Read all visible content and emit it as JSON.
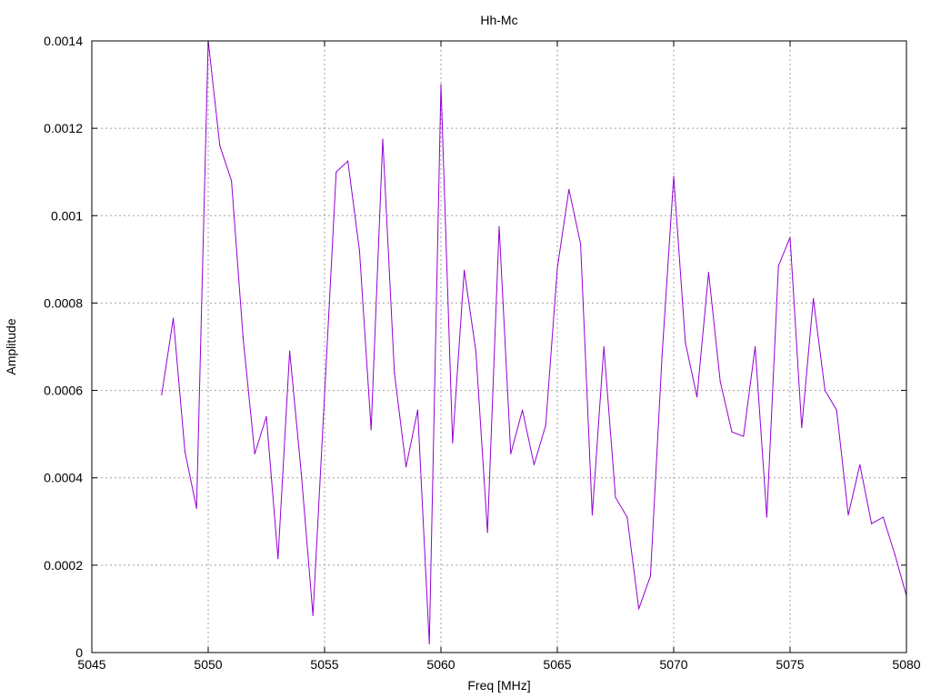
{
  "chart_data": {
    "type": "line",
    "title": "Hh-Mc",
    "xlabel": "Freq [MHz]",
    "ylabel": "Amplitude",
    "xlim": [
      5045,
      5080
    ],
    "ylim": [
      0,
      0.0014
    ],
    "xticks": [
      5045,
      5050,
      5055,
      5060,
      5065,
      5070,
      5075,
      5080
    ],
    "yticks": [
      0,
      0.0002,
      0.0004,
      0.0006,
      0.0008,
      0.001,
      0.0012,
      0.0014
    ],
    "xtick_labels": [
      "5045",
      "5050",
      "5055",
      "5060",
      "5065",
      "5070",
      "5075",
      "5080"
    ],
    "ytick_labels": [
      "0",
      "0.0002",
      "0.0004",
      "0.0006",
      "0.0008",
      "0.001",
      "0.0012",
      "0.0014"
    ],
    "grid": true,
    "series": [
      {
        "color": "#9400d3",
        "x": [
          5048,
          5048.5,
          5049,
          5049.5,
          5050,
          5050.5,
          5051,
          5051.5,
          5052,
          5052.5,
          5053,
          5053.5,
          5054,
          5054.5,
          5055,
          5055.5,
          5056,
          5056.5,
          5057,
          5057.5,
          5058,
          5058.5,
          5059,
          5059.5,
          5060,
          5060.5,
          5061,
          5061.5,
          5062,
          5062.5,
          5063,
          5063.5,
          5064,
          5064.5,
          5065,
          5065.5,
          5066,
          5066.5,
          5067,
          5067.5,
          5068,
          5068.5,
          5069,
          5069.5,
          5070,
          5070.5,
          5071,
          5071.5,
          5072,
          5072.5,
          5073,
          5073.5,
          5074,
          5074.5,
          5075,
          5075.5,
          5076,
          5076.5,
          5077,
          5077.5,
          5078,
          5078.5,
          5079,
          5079.5,
          5080
        ],
        "y": [
          0.00059,
          0.000765,
          0.00046,
          0.00033,
          0.0014,
          0.00116,
          0.00108,
          0.00072,
          0.000455,
          0.00054,
          0.000215,
          0.00069,
          0.00041,
          8.5e-05,
          0.00059,
          0.0011,
          0.001125,
          0.00092,
          0.00051,
          0.001175,
          0.00064,
          0.000425,
          0.000555,
          2e-05,
          0.0013,
          0.00048,
          0.000875,
          0.00069,
          0.000275,
          0.000975,
          0.000455,
          0.000555,
          0.00043,
          0.00052,
          0.00088,
          0.00106,
          0.000935,
          0.000315,
          0.0007,
          0.000355,
          0.00031,
          0.0001,
          0.000175,
          0.00068,
          0.00109,
          0.00071,
          0.000585,
          0.00087,
          0.00062,
          0.000505,
          0.000495,
          0.0007,
          0.00031,
          0.000885,
          0.00095,
          0.000515,
          0.00081,
          0.0006,
          0.000555,
          0.000315,
          0.00043,
          0.000295,
          0.00031,
          0.000225,
          0.00013
        ]
      }
    ]
  }
}
